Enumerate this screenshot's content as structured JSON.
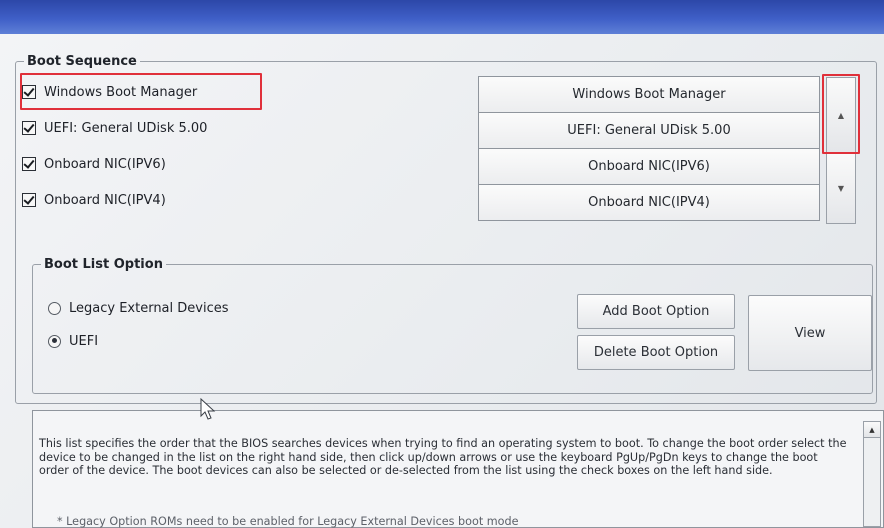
{
  "boot_sequence": {
    "title": "Boot Sequence",
    "items": [
      {
        "label": "Windows Boot Manager",
        "checked": true
      },
      {
        "label": "UEFI: General UDisk 5.00",
        "checked": true
      },
      {
        "label": "Onboard NIC(IPV6)",
        "checked": true
      },
      {
        "label": "Onboard NIC(IPV4)",
        "checked": true
      }
    ],
    "order": [
      "Windows Boot Manager",
      "UEFI: General UDisk 5.00",
      "Onboard NIC(IPV6)",
      "Onboard NIC(IPV4)"
    ],
    "up_icon": "arrow-up-icon",
    "down_icon": "arrow-down-icon"
  },
  "boot_list_option": {
    "title": "Boot List Option",
    "options": [
      {
        "label": "Legacy External Devices",
        "selected": false
      },
      {
        "label": "UEFI",
        "selected": true
      }
    ],
    "add_label": "Add Boot Option",
    "delete_label": "Delete Boot Option",
    "view_label": "View"
  },
  "help": {
    "text": "This list specifies the order that the BIOS searches devices when trying to find an operating system to boot. To change the boot order select the device to be changed in the list on the right hand side, then click up/down arrows or use the keyboard PgUp/PgDn keys to change the boot order of the device. The boot devices can also be selected or de-selected from the list using the check boxes on the left hand side.",
    "note": "* Legacy Option ROMs need to be enabled for Legacy External Devices boot mode"
  },
  "colors": {
    "header_blue": "#3f5fc7",
    "highlight_red": "#e0303a"
  }
}
